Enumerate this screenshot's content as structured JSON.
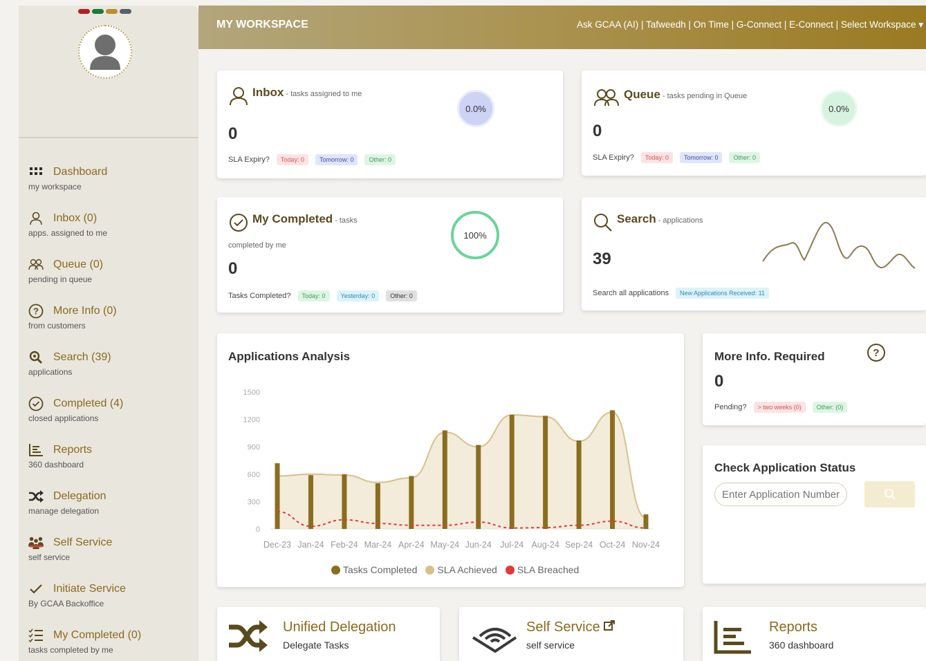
{
  "header": {
    "title": "MY WORKSPACE",
    "links": "Ask GCAA (AI) | Tafweedh | On Time | G-Connect | E-Connect | Select Workspace ▾"
  },
  "flags": [
    "#b81c22",
    "#1a7a3a",
    "#b9902f",
    "#56606a"
  ],
  "sidebar": {
    "items": [
      {
        "icon": "grid-icon",
        "label": "Dashboard",
        "sub": "my workspace"
      },
      {
        "icon": "user-icon",
        "label": "Inbox (0)",
        "sub": "apps. assigned to me"
      },
      {
        "icon": "users-icon",
        "label": "Queue (0)",
        "sub": "pending in queue"
      },
      {
        "icon": "question-circle-icon",
        "label": "More Info (0)",
        "sub": "from customers"
      },
      {
        "icon": "search-icon",
        "label": "Search (39)",
        "sub": "applications"
      },
      {
        "icon": "check-circle-icon",
        "label": "Completed (4)",
        "sub": "closed applications"
      },
      {
        "icon": "reports-icon",
        "label": "Reports",
        "sub": "360 dashboard"
      },
      {
        "icon": "shuffle-icon",
        "label": "Delegation",
        "sub": "manage delegation"
      },
      {
        "icon": "people-icon",
        "label": "Self Service",
        "sub": "self service"
      },
      {
        "icon": "check-icon",
        "label": "Initiate Service",
        "sub": "By GCAA Backoffice"
      },
      {
        "icon": "list-check-icon",
        "label": "My Completed (0)",
        "sub": "tasks completed by me"
      }
    ]
  },
  "cards": {
    "inbox": {
      "title": "Inbox",
      "sub": "- tasks assigned to me",
      "count": "0",
      "percent": "0.0%",
      "label": "SLA Expiry?",
      "today": "Today: 0",
      "tomorrow": "Tomorrow: 0",
      "other": "Other: 0"
    },
    "queue": {
      "title": "Queue",
      "sub": "- tasks pending in Queue",
      "count": "0",
      "percent": "0.0%",
      "label": "SLA Expiry?",
      "today": "Today: 0",
      "tomorrow": "Tomorrow: 0",
      "other": "Other: 0"
    },
    "completed": {
      "title": "My Completed",
      "sub": "- tasks",
      "sub2": "completed by me",
      "count": "0",
      "percent": "100%",
      "label": "Tasks Completed?",
      "today": "Today: 0",
      "yesterday": "Yesterday: 0",
      "other": "Other: 0"
    },
    "search": {
      "title": "Search",
      "sub": "- applications",
      "count": "39",
      "label": "Search all applications",
      "received": "New Applications Received: 11"
    }
  },
  "analysis": {
    "title": "Applications Analysis"
  },
  "chart_data": {
    "type": "bar",
    "title": "Applications Analysis",
    "categories": [
      "Dec-23",
      "Jan-24",
      "Feb-24",
      "Mar-24",
      "Apr-24",
      "May-24",
      "Jun-24",
      "Jul-24",
      "Aug-24",
      "Sep-24",
      "Oct-24",
      "Nov-24"
    ],
    "yticks": [
      0,
      300,
      600,
      900,
      1200,
      1500
    ],
    "ylim": [
      0,
      1500
    ],
    "series": [
      {
        "name": "Tasks Completed",
        "kind": "bar",
        "color": "#8b6d20",
        "values": [
          720,
          590,
          600,
          500,
          580,
          1080,
          920,
          1250,
          1240,
          970,
          1300,
          160
        ]
      },
      {
        "name": "SLA Achieved",
        "kind": "area",
        "color": "#d9c08a",
        "values": [
          580,
          600,
          590,
          510,
          560,
          1060,
          900,
          1250,
          1230,
          960,
          1280,
          120
        ]
      },
      {
        "name": "SLA Breached",
        "kind": "line-dashed",
        "color": "#e53935",
        "values": [
          190,
          30,
          100,
          60,
          40,
          40,
          75,
          10,
          15,
          40,
          85,
          10
        ]
      }
    ],
    "legend": "bottom"
  },
  "more_info": {
    "title": "More Info. Required",
    "count": "0",
    "label": "Pending?",
    "weeks": "> two weeks (0)",
    "other": "Other: (0)"
  },
  "check_status": {
    "title": "Check Application Status",
    "placeholder": "Enter Application Number"
  },
  "tiles": [
    {
      "title": "Unified Delegation",
      "sub": "Delegate Tasks"
    },
    {
      "title": "Self Service",
      "sub": "self service"
    },
    {
      "title": "Reports",
      "sub": "360 dashboard"
    }
  ]
}
